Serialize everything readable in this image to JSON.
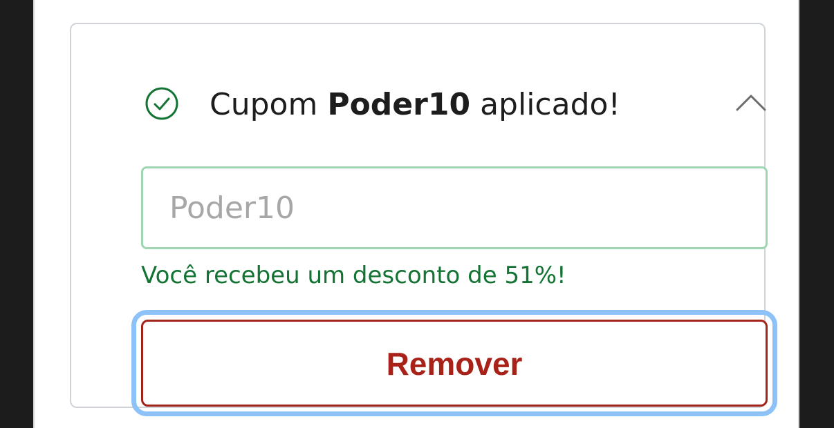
{
  "coupon": {
    "header_prefix": "Cupom",
    "code": "Poder10",
    "header_suffix": "aplicado!",
    "input_placeholder": "Poder10",
    "input_value": "",
    "success_message": "Você recebeu um desconto de 51%!",
    "remove_label": "Remover"
  },
  "colors": {
    "success": "#137333",
    "danger": "#a8221a",
    "focus_ring": "#8cc2f7",
    "input_border": "#9fd6b2"
  },
  "icons": {
    "status": "check-circle-icon",
    "toggle": "chevron-up-icon"
  }
}
